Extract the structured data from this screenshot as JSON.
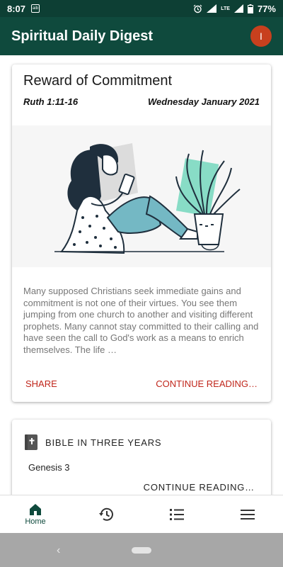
{
  "status_bar": {
    "time": "8:07",
    "notif_text": "aib",
    "network": "LTE",
    "battery": "77%"
  },
  "app_bar": {
    "title": "Spiritual Daily Digest",
    "avatar_letter": "I"
  },
  "devotional_card": {
    "title": "Reward of Commitment",
    "reference": "Ruth 1:11-16",
    "date": "Wednesday January 2021",
    "excerpt": "Many supposed Christians seek immediate gains and commitment is not one of their virtues. You see them jumping from one church to another and visiting different prophets. Many cannot stay committed to their calling and have seen the call to God's work as a means to enrich themselves. The life …",
    "share_label": "SHARE",
    "continue_label": "CONTINUE READING…"
  },
  "bible_card": {
    "title": "BIBLE IN THREE YEARS",
    "passage": "Genesis 3",
    "continue_label": "CONTINUE READING…"
  },
  "bottom_nav": {
    "items": [
      {
        "label": "Home",
        "icon": "home-icon"
      },
      {
        "label": "",
        "icon": "history-icon"
      },
      {
        "label": "",
        "icon": "list-icon"
      },
      {
        "label": "",
        "icon": "menu-icon"
      }
    ]
  },
  "colors": {
    "app_bar": "#0f4a3d",
    "status_bar": "#0d3f34",
    "accent": "#c0261b",
    "avatar": "#c8401e"
  }
}
